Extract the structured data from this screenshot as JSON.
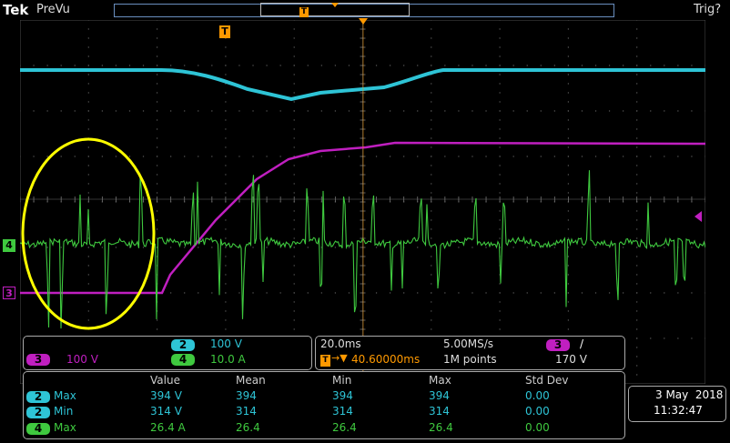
{
  "header": {
    "brand": "Tek",
    "mode": "PreVu",
    "trigger_status": "Trig?"
  },
  "markers": {
    "trigger_letter": "T"
  },
  "colors": {
    "ch2": "#2ec4d6",
    "ch3": "#c01fc0",
    "ch4": "#3fc93f",
    "trigger": "#ff9900",
    "annotation": "#ffff00",
    "grid": "#404040"
  },
  "channels_panel": {
    "ch2": {
      "num": "2",
      "scale": "100 V"
    },
    "ch3": {
      "num": "3",
      "scale": "100 V"
    },
    "ch4": {
      "num": "4",
      "scale": "10.0 A"
    }
  },
  "timebase_panel": {
    "time_per_div": "20.0ms",
    "sample_rate": "5.00MS/s",
    "trigger_channel": "3",
    "trigger_slope": "/",
    "position": "40.60000ms",
    "record_length": "1M points",
    "trigger_level": "170 V"
  },
  "measurements": {
    "headers": [
      "Value",
      "Mean",
      "Min",
      "Max",
      "Std Dev"
    ],
    "rows": [
      {
        "ch": "2",
        "label": "Max",
        "value": "394 V",
        "mean": "394",
        "min": "394",
        "max": "394",
        "std": "0.00"
      },
      {
        "ch": "2",
        "label": "Min",
        "value": "314 V",
        "mean": "314",
        "min": "314",
        "max": "314",
        "std": "0.00"
      },
      {
        "ch": "4",
        "label": "Max",
        "value": "26.4 A",
        "mean": "26.4",
        "min": "26.4",
        "max": "26.4",
        "std": "0.00"
      }
    ]
  },
  "datetime": {
    "date": "3 May  2018",
    "time": "11:32:47"
  }
}
